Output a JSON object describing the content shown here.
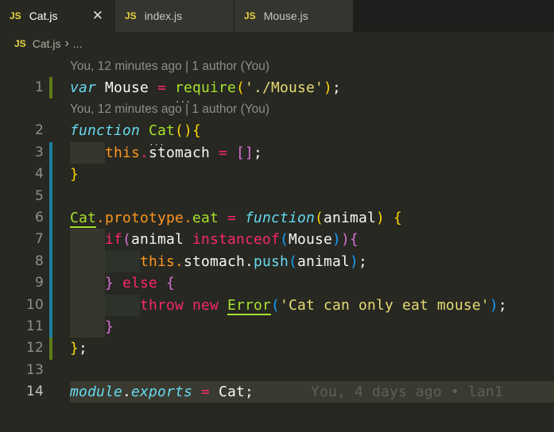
{
  "tabs": [
    {
      "icon": "JS",
      "label": "Cat.js",
      "active": true,
      "close": "✕"
    },
    {
      "icon": "JS",
      "label": "index.js",
      "active": false
    },
    {
      "icon": "JS",
      "label": "Mouse.js",
      "active": false
    }
  ],
  "breadcrumb": {
    "icon": "JS",
    "file": "Cat.js",
    "sep": "›",
    "rest": "..."
  },
  "colors": {
    "background": "#272822",
    "keyword": "#f92672",
    "function": "#a6e22e",
    "storage": "#66d9ef",
    "string": "#e6db74",
    "git_added": "#5f7a19",
    "git_modified": "#1d7ea0"
  },
  "lines": [
    {
      "lens": "You, 12 minutes ago | 1 author (You)",
      "num": "1",
      "git": "green",
      "tokens": [
        [
          "var",
          "st"
        ],
        [
          " Mouse ",
          "wh"
        ],
        [
          "=",
          "op"
        ],
        [
          " ",
          "wh"
        ],
        [
          "require",
          "fn dots"
        ],
        [
          "(",
          "by"
        ],
        [
          "'./Mouse'",
          "str"
        ],
        [
          ")",
          "by"
        ],
        [
          ";",
          "wh"
        ]
      ]
    },
    {
      "lens": "You, 12 minutes ago | 1 author (You)",
      "num": "2",
      "tokens": [
        [
          "function",
          "st"
        ],
        [
          " ",
          "wh"
        ],
        [
          "Cat",
          "fn dots"
        ],
        [
          "()",
          "by"
        ],
        [
          "{",
          "by"
        ]
      ]
    },
    {
      "num": "3",
      "git": "blue",
      "guides": 1,
      "tokens": [
        [
          "    ",
          "wh"
        ],
        [
          "this",
          "or"
        ],
        [
          ".",
          "op"
        ],
        [
          "stomach ",
          "wh"
        ],
        [
          "=",
          "op"
        ],
        [
          " ",
          "wh"
        ],
        [
          "[]",
          "bp"
        ],
        [
          ";",
          "wh"
        ]
      ]
    },
    {
      "num": "4",
      "git": "blue",
      "tokens": [
        [
          "}",
          "by"
        ]
      ]
    },
    {
      "num": "5",
      "git": "blue",
      "tokens": []
    },
    {
      "num": "6",
      "git": "blue",
      "tokens": [
        [
          "Cat",
          "fn ul"
        ],
        [
          ".",
          "or"
        ],
        [
          "prototype",
          "or"
        ],
        [
          ".",
          "or"
        ],
        [
          "eat",
          "fn"
        ],
        [
          " ",
          "wh"
        ],
        [
          "=",
          "op"
        ],
        [
          " ",
          "wh"
        ],
        [
          "function",
          "st"
        ],
        [
          "(",
          "by"
        ],
        [
          "animal",
          "wh"
        ],
        [
          ")",
          "by"
        ],
        [
          " ",
          "wh"
        ],
        [
          "{",
          "by"
        ]
      ]
    },
    {
      "num": "7",
      "git": "blue",
      "guides": 1,
      "tokens": [
        [
          "    ",
          "wh"
        ],
        [
          "if",
          "kw"
        ],
        [
          "(",
          "bp"
        ],
        [
          "animal ",
          "wh"
        ],
        [
          "instanceof",
          "kw"
        ],
        [
          "(",
          "bb"
        ],
        [
          "Mouse",
          "wh"
        ],
        [
          ")",
          "bb"
        ],
        [
          ")",
          "bp"
        ],
        [
          "{",
          "bp"
        ]
      ]
    },
    {
      "num": "8",
      "git": "blue",
      "guides": 2,
      "tokens": [
        [
          "        ",
          "wh"
        ],
        [
          "this",
          "or"
        ],
        [
          ".",
          "or"
        ],
        [
          "stomach",
          "wh"
        ],
        [
          ".",
          "wh"
        ],
        [
          "push",
          "cy"
        ],
        [
          "(",
          "bb"
        ],
        [
          "animal",
          "wh"
        ],
        [
          ")",
          "bb"
        ],
        [
          ";",
          "wh"
        ]
      ]
    },
    {
      "num": "9",
      "git": "blue",
      "guides": 1,
      "tokens": [
        [
          "    ",
          "wh"
        ],
        [
          "}",
          "bp"
        ],
        [
          " ",
          "wh"
        ],
        [
          "else",
          "kw"
        ],
        [
          " ",
          "wh"
        ],
        [
          "{",
          "bp"
        ]
      ]
    },
    {
      "num": "10",
      "git": "blue",
      "guides": 2,
      "tokens": [
        [
          "        ",
          "wh"
        ],
        [
          "throw",
          "kw"
        ],
        [
          " ",
          "wh"
        ],
        [
          "new",
          "kw"
        ],
        [
          " ",
          "wh"
        ],
        [
          "Error",
          "fn ul"
        ],
        [
          "(",
          "bb"
        ],
        [
          "'Cat can only eat mouse'",
          "str"
        ],
        [
          ")",
          "bb"
        ],
        [
          ";",
          "wh"
        ]
      ]
    },
    {
      "num": "11",
      "git": "blue",
      "guides": 1,
      "tokens": [
        [
          "    ",
          "wh"
        ],
        [
          "}",
          "bp"
        ]
      ]
    },
    {
      "num": "12",
      "git": "green",
      "tokens": [
        [
          "}",
          "by"
        ],
        [
          ";",
          "wh"
        ]
      ]
    },
    {
      "num": "13",
      "tokens": []
    },
    {
      "num": "14",
      "current": true,
      "blame": "You, 4 days ago • lan1",
      "tokens": [
        [
          "module",
          "kw st"
        ],
        [
          ".",
          "wh"
        ],
        [
          "exports",
          "st"
        ],
        [
          " ",
          "wh"
        ],
        [
          "=",
          "op"
        ],
        [
          " ",
          "wh"
        ],
        [
          "Cat",
          "wh"
        ],
        [
          ";",
          "wh"
        ]
      ]
    }
  ]
}
